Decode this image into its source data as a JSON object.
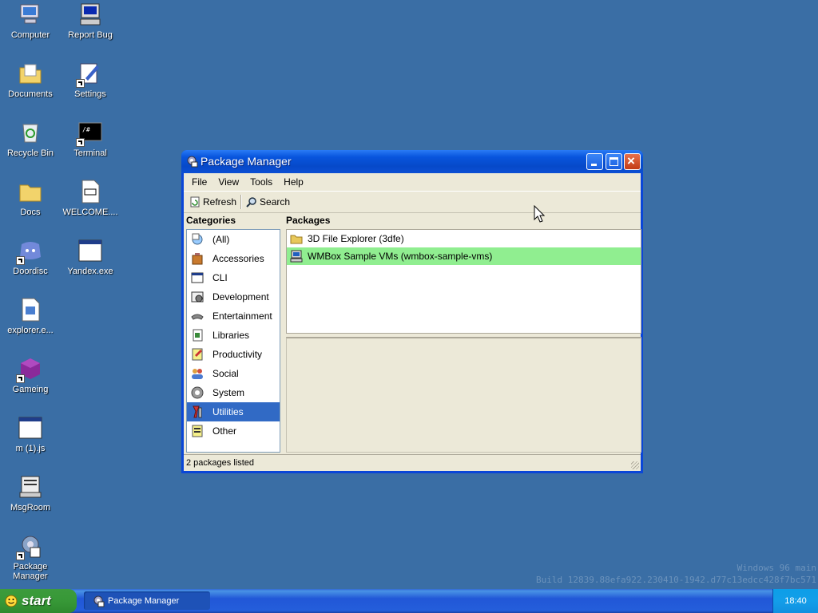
{
  "desktop": {
    "icons": [
      {
        "label": "Computer"
      },
      {
        "label": "Report Bug"
      },
      {
        "label": "Documents"
      },
      {
        "label": "Settings"
      },
      {
        "label": "Recycle Bin"
      },
      {
        "label": "Terminal"
      },
      {
        "label": "Docs"
      },
      {
        "label": "WELCOME...."
      },
      {
        "label": "Doordisc"
      },
      {
        "label": "Yandex.exe"
      },
      {
        "label": "explorer.e..."
      },
      {
        "label": "Gameing"
      },
      {
        "label": "m (1).js"
      },
      {
        "label": "MsgRoom"
      },
      {
        "label": "Package Manager"
      }
    ],
    "watermark": {
      "line1": "Windows 96 main",
      "line2": "Build 12839.88efa922.230410-1942.d77c13edcc428f7bc571"
    }
  },
  "window": {
    "title": "Package Manager",
    "menu": [
      "File",
      "View",
      "Tools",
      "Help"
    ],
    "toolbar": {
      "refresh": "Refresh",
      "search": "Search"
    },
    "categories_header": "Categories",
    "packages_header": "Packages",
    "categories": [
      {
        "label": "(All)",
        "icon": "all-icon"
      },
      {
        "label": "Accessories",
        "icon": "accessories-icon"
      },
      {
        "label": "CLI",
        "icon": "cli-icon"
      },
      {
        "label": "Development",
        "icon": "development-icon"
      },
      {
        "label": "Entertainment",
        "icon": "entertainment-icon"
      },
      {
        "label": "Libraries",
        "icon": "libraries-icon"
      },
      {
        "label": "Productivity",
        "icon": "productivity-icon"
      },
      {
        "label": "Social",
        "icon": "social-icon"
      },
      {
        "label": "System",
        "icon": "system-icon"
      },
      {
        "label": "Utilities",
        "icon": "utilities-icon",
        "selected": true
      },
      {
        "label": "Other",
        "icon": "other-icon"
      }
    ],
    "packages": [
      {
        "label": "3D File Explorer (3dfe)",
        "icon": "folder-icon"
      },
      {
        "label": "WMBox Sample VMs (wmbox-sample-vms)",
        "icon": "computer-icon",
        "selected": true
      }
    ],
    "status": "2 packages listed"
  },
  "taskbar": {
    "start_label": "start",
    "tasks": [
      {
        "label": "Package Manager"
      }
    ],
    "clock": "18:40"
  },
  "colors": {
    "desktop": "#3a6ea5",
    "selected_category": "#316ac5",
    "selected_package": "#90ee90"
  }
}
